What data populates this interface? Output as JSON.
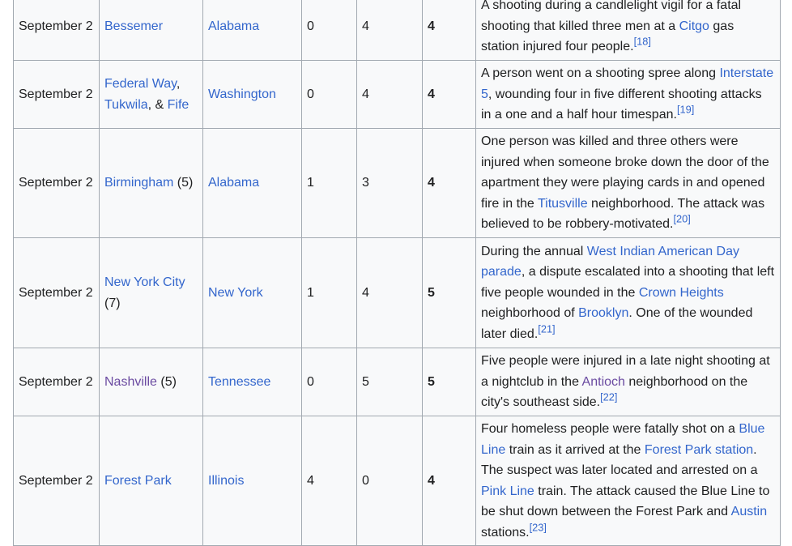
{
  "rows": [
    {
      "date": "September 2",
      "city": [
        {
          "t": "Bessemer",
          "link": true
        }
      ],
      "state": "Alabama",
      "dead": "0",
      "injured": "4",
      "total": "4",
      "desc": [
        {
          "t": "A shooting during a candlelight vigil for a fatal shooting that killed three men at a "
        },
        {
          "t": "Citgo",
          "link": true
        },
        {
          "t": " gas station injured four people."
        },
        {
          "t": "[18]",
          "ref": true
        }
      ],
      "height": 84
    },
    {
      "date": "September 2",
      "city": [
        {
          "t": "Federal Way",
          "link": true
        },
        {
          "t": ", "
        },
        {
          "t": "Tukwila",
          "link": true
        },
        {
          "t": ", & "
        },
        {
          "t": "Fife",
          "link": true
        }
      ],
      "state": "Washington",
      "dead": "0",
      "injured": "4",
      "total": "4",
      "desc": [
        {
          "t": "A person went on a shooting spree along "
        },
        {
          "t": "Interstate 5",
          "link": true
        },
        {
          "t": ", wounding four in five different shooting attacks in a one and a half hour timespan."
        },
        {
          "t": "[19]",
          "ref": true
        }
      ],
      "height": 84
    },
    {
      "date": "September 2",
      "city": [
        {
          "t": "Birmingham",
          "link": true
        },
        {
          "t": " (5)"
        }
      ],
      "state": "Alabama",
      "dead": "1",
      "injured": "3",
      "total": "4",
      "desc": [
        {
          "t": "One person was killed and three others were injured when someone broke down the door of the apartment they were playing cards in and opened fire in the "
        },
        {
          "t": "Titusville",
          "link": true
        },
        {
          "t": " neighborhood. The attack was believed to be robbery-motivated."
        },
        {
          "t": "[20]",
          "ref": true
        }
      ],
      "height": 135
    },
    {
      "date": "September 2",
      "city": [
        {
          "t": "New York City",
          "link": true
        },
        {
          "t": " (7)"
        }
      ],
      "state": "New York",
      "dead": "1",
      "injured": "4",
      "total": "5",
      "desc": [
        {
          "t": "During the annual "
        },
        {
          "t": "West Indian American Day parade",
          "link": true
        },
        {
          "t": ", a dispute escalated into a shooting that left five people wounded in the "
        },
        {
          "t": "Crown Heights",
          "link": true
        },
        {
          "t": " neighborhood of "
        },
        {
          "t": "Brooklyn",
          "link": true
        },
        {
          "t": ". One of the wounded later died."
        },
        {
          "t": "[21]",
          "ref": true
        }
      ],
      "height": 136
    },
    {
      "date": "September 2",
      "city": [
        {
          "t": "Nashville",
          "link": true,
          "visited": true
        },
        {
          "t": " (5)"
        }
      ],
      "state": "Tennessee",
      "dead": "0",
      "injured": "5",
      "total": "5",
      "desc": [
        {
          "t": "Five people were injured in a late night shooting at a nightclub in the "
        },
        {
          "t": "Antioch",
          "link": true,
          "visited": true
        },
        {
          "t": " neighborhood on the city's southeast side."
        },
        {
          "t": "[22]",
          "ref": true
        }
      ],
      "height": 84
    },
    {
      "date": "September 2",
      "city": [
        {
          "t": "Forest Park",
          "link": true
        }
      ],
      "state": "Illinois",
      "dead": "4",
      "injured": "0",
      "total": "4",
      "desc": [
        {
          "t": "Four homeless people were fatally shot on a "
        },
        {
          "t": "Blue Line",
          "link": true
        },
        {
          "t": " train as it arrived at the "
        },
        {
          "t": "Forest Park station",
          "link": true
        },
        {
          "t": ". The suspect was later located and arrested on a "
        },
        {
          "t": "Pink Line",
          "link": true
        },
        {
          "t": " train. The attack caused the Blue Line to be shut down between the Forest Park and "
        },
        {
          "t": "Austin",
          "link": true
        },
        {
          "t": " stations."
        },
        {
          "t": "[23]",
          "ref": true
        }
      ],
      "height": 160
    }
  ]
}
